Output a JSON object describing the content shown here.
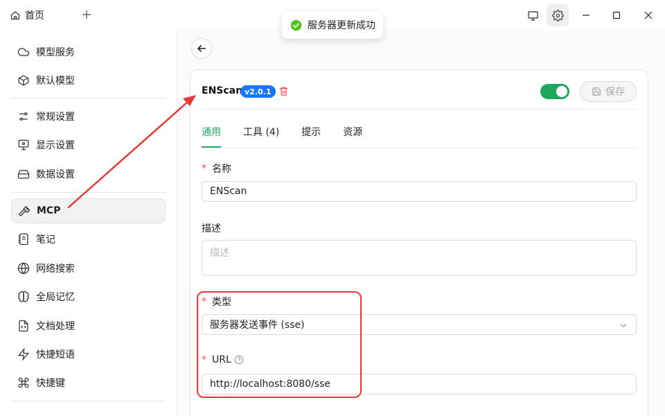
{
  "titlebar": {
    "home_tab": "首页",
    "add_tab": "+"
  },
  "toast": {
    "message": "服务器更新成功",
    "icon": "check-circle-icon",
    "color": "#52c41a"
  },
  "sidebar": {
    "items": [
      {
        "label": "模型服务",
        "icon": "cloud-icon"
      },
      {
        "label": "默认模型",
        "icon": "cube-icon"
      },
      {
        "label": "常规设置",
        "icon": "sliders-icon"
      },
      {
        "label": "显示设置",
        "icon": "monitor-settings-icon"
      },
      {
        "label": "数据设置",
        "icon": "hard-drive-icon"
      },
      {
        "label": "MCP",
        "icon": "hammer-icon",
        "active": true
      },
      {
        "label": "笔记",
        "icon": "notebook-icon"
      },
      {
        "label": "网络搜索",
        "icon": "globe-icon"
      },
      {
        "label": "全局记忆",
        "icon": "brain-icon"
      },
      {
        "label": "文档处理",
        "icon": "file-code-icon"
      },
      {
        "label": "快捷短语",
        "icon": "zap-icon"
      },
      {
        "label": "快捷键",
        "icon": "command-icon"
      }
    ]
  },
  "server": {
    "name": "ENScan",
    "version": "v2.0.1",
    "enabled": true,
    "save_label": "保存"
  },
  "tabs": [
    {
      "label": "通用",
      "active": true
    },
    {
      "label": "工具 (4)"
    },
    {
      "label": "提示"
    },
    {
      "label": "资源"
    }
  ],
  "form": {
    "name_label": "名称",
    "name_value": "ENScan",
    "desc_label": "描述",
    "desc_placeholder": "描述",
    "type_label": "类型",
    "type_value": "服务器发送事件 (sse)",
    "url_label": "URL",
    "url_value": "http://localhost:8080/sse",
    "required_mark": "*"
  },
  "colors": {
    "accent": "#1ea85f",
    "badge": "#1677ff",
    "annotation": "#e53935",
    "danger": "#ff4d4f"
  }
}
